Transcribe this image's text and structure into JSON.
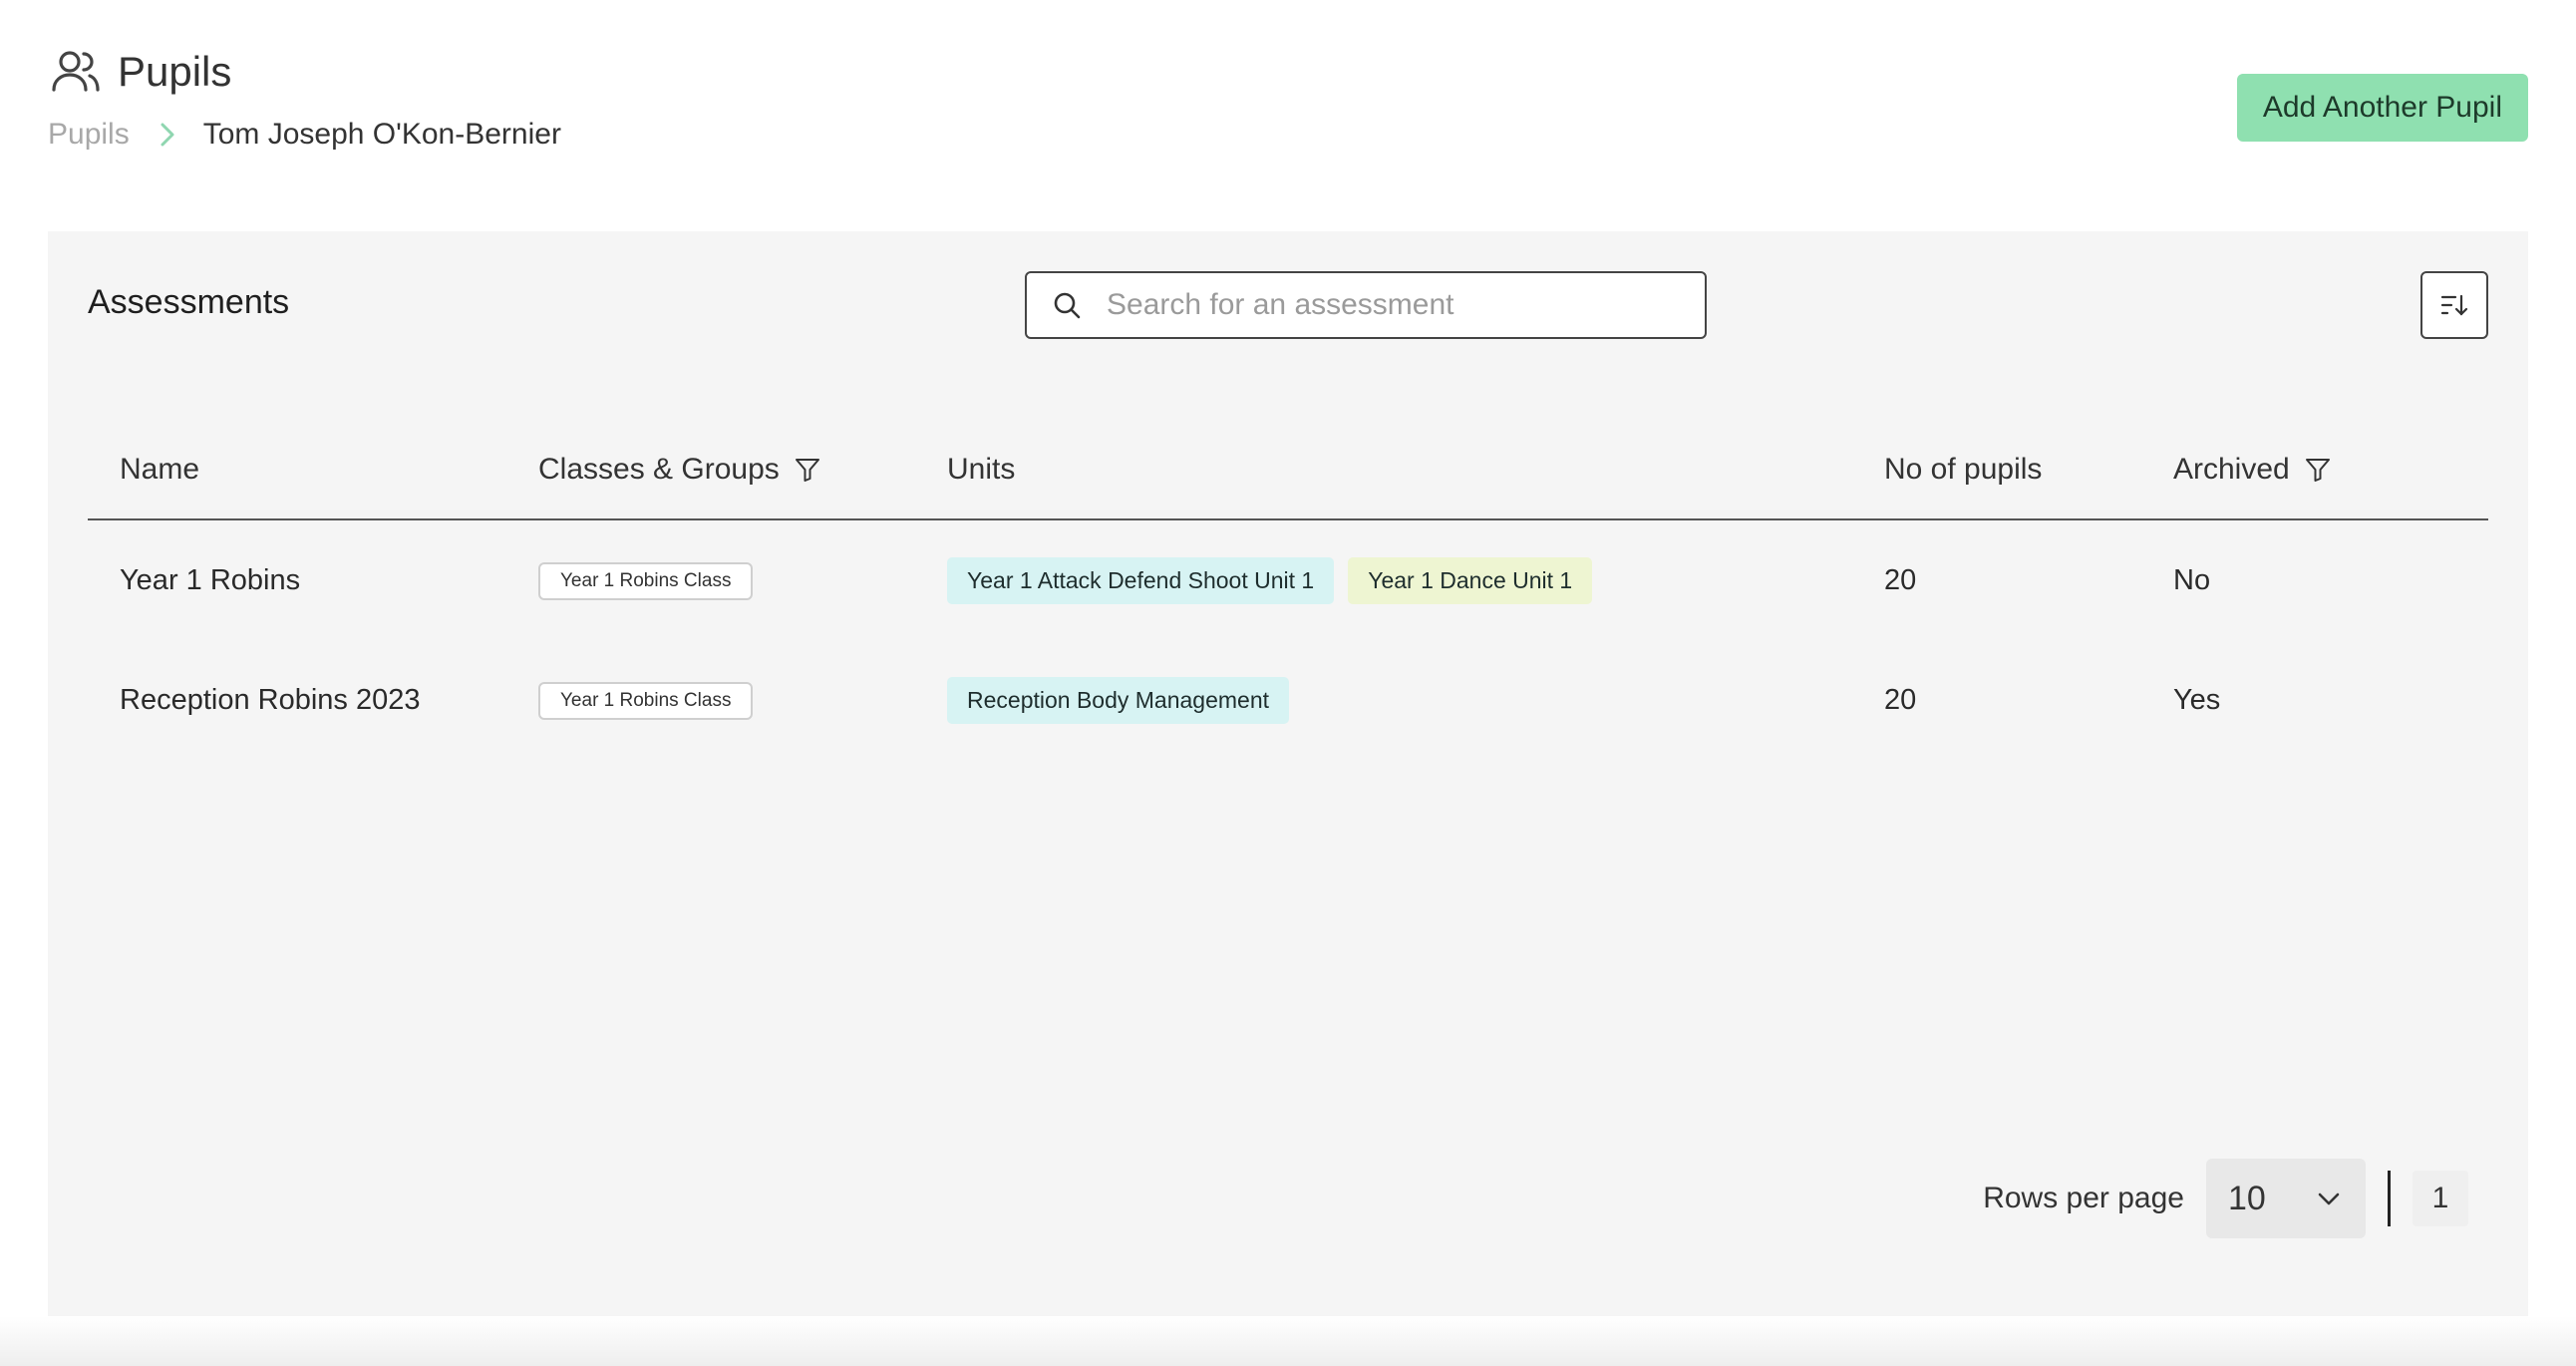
{
  "header": {
    "title": "Pupils",
    "breadcrumb_root": "Pupils",
    "breadcrumb_current": "Tom Joseph O'Kon-Bernier",
    "add_button_label": "Add Another Pupil"
  },
  "panel": {
    "title": "Assessments",
    "search_placeholder": "Search for an assessment"
  },
  "table": {
    "columns": {
      "name": "Name",
      "classes": "Classes & Groups",
      "units": "Units",
      "pupils": "No of pupils",
      "archived": "Archived"
    },
    "rows": [
      {
        "name": "Year 1 Robins",
        "class": "Year 1 Robins Class",
        "units": [
          "Year 1 Attack Defend Shoot Unit 1",
          "Year 1 Dance Unit 1"
        ],
        "pupils": "20",
        "archived": "No"
      },
      {
        "name": "Reception Robins 2023",
        "class": "Year 1 Robins Class",
        "units": [
          "Reception Body Management"
        ],
        "pupils": "20",
        "archived": "Yes"
      }
    ]
  },
  "pagination": {
    "rows_label": "Rows per page",
    "rows_value": "10",
    "current_page": "1"
  },
  "colors": {
    "accent_green": "#8fe0b0",
    "unit_cyan": "#d7f3f3",
    "unit_yellow": "#eef5d2",
    "panel_bg": "#f5f5f5"
  }
}
